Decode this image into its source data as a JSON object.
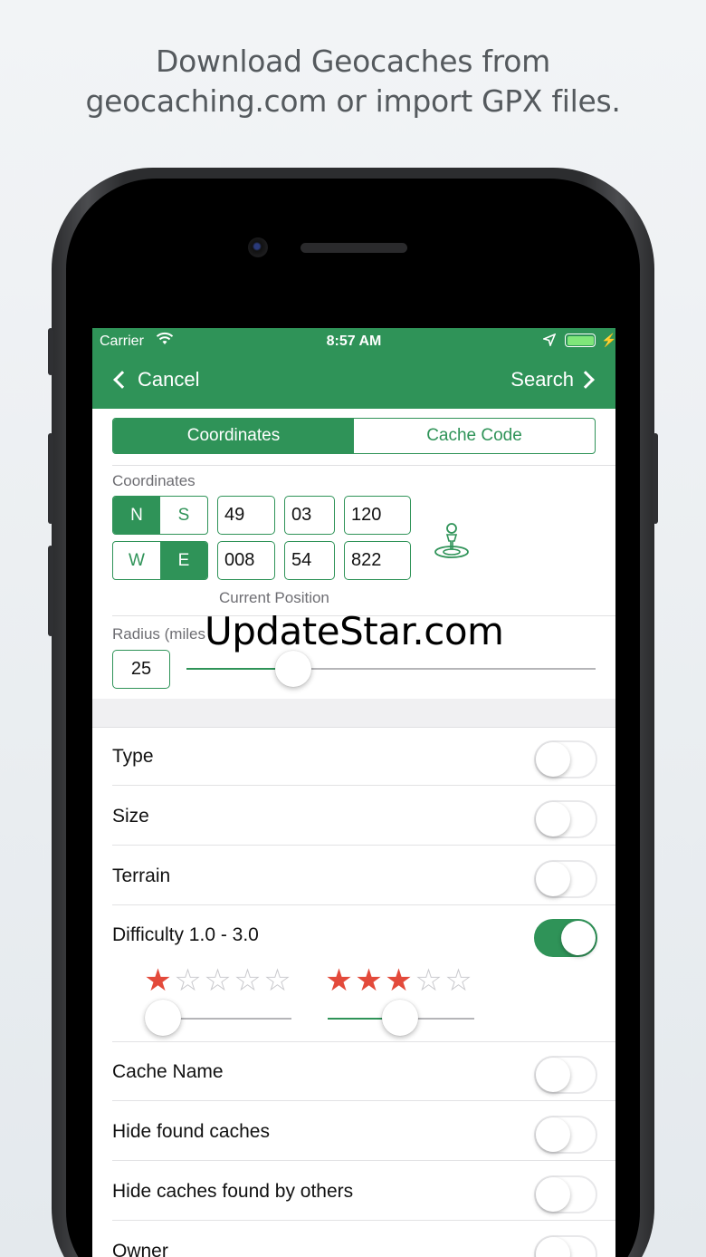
{
  "headline": {
    "line1": "Download Geocaches from",
    "line2": "geocaching.com or import GPX files."
  },
  "status_bar": {
    "carrier": "Carrier",
    "time": "8:57 AM"
  },
  "nav": {
    "cancel_label": "Cancel",
    "search_label": "Search"
  },
  "segments": {
    "items": [
      "Coordinates",
      "Cache Code"
    ],
    "selected": "Coordinates"
  },
  "coordinates": {
    "section_label": "Coordinates",
    "lat": {
      "hemisphere_options": [
        "N",
        "S"
      ],
      "selected": "N",
      "degrees": "49",
      "minutes": "03",
      "thousandths": "120"
    },
    "lon": {
      "hemisphere_options": [
        "W",
        "E"
      ],
      "selected": "E",
      "degrees": "008",
      "minutes": "54",
      "thousandths": "822"
    },
    "current_position_label": "Current Position"
  },
  "radius": {
    "label": "Radius (miles",
    "value": "25",
    "slider_fraction": 0.26
  },
  "filters": [
    {
      "label": "Type",
      "on": false
    },
    {
      "label": "Size",
      "on": false
    },
    {
      "label": "Terrain",
      "on": false
    },
    {
      "label": "Difficulty 1.0 - 3.0",
      "on": true
    },
    {
      "label": "Cache Name",
      "on": false
    },
    {
      "label": "Hide found caches",
      "on": false
    },
    {
      "label": "Hide caches found by others",
      "on": false
    },
    {
      "label": "Owner",
      "on": false
    }
  ],
  "difficulty": {
    "min_stars": 1,
    "max_stars": 3,
    "total_stars": 5
  },
  "watermark": "UpdateStar.com",
  "colors": {
    "accent": "#2f9358",
    "star": "#e34a3b"
  }
}
